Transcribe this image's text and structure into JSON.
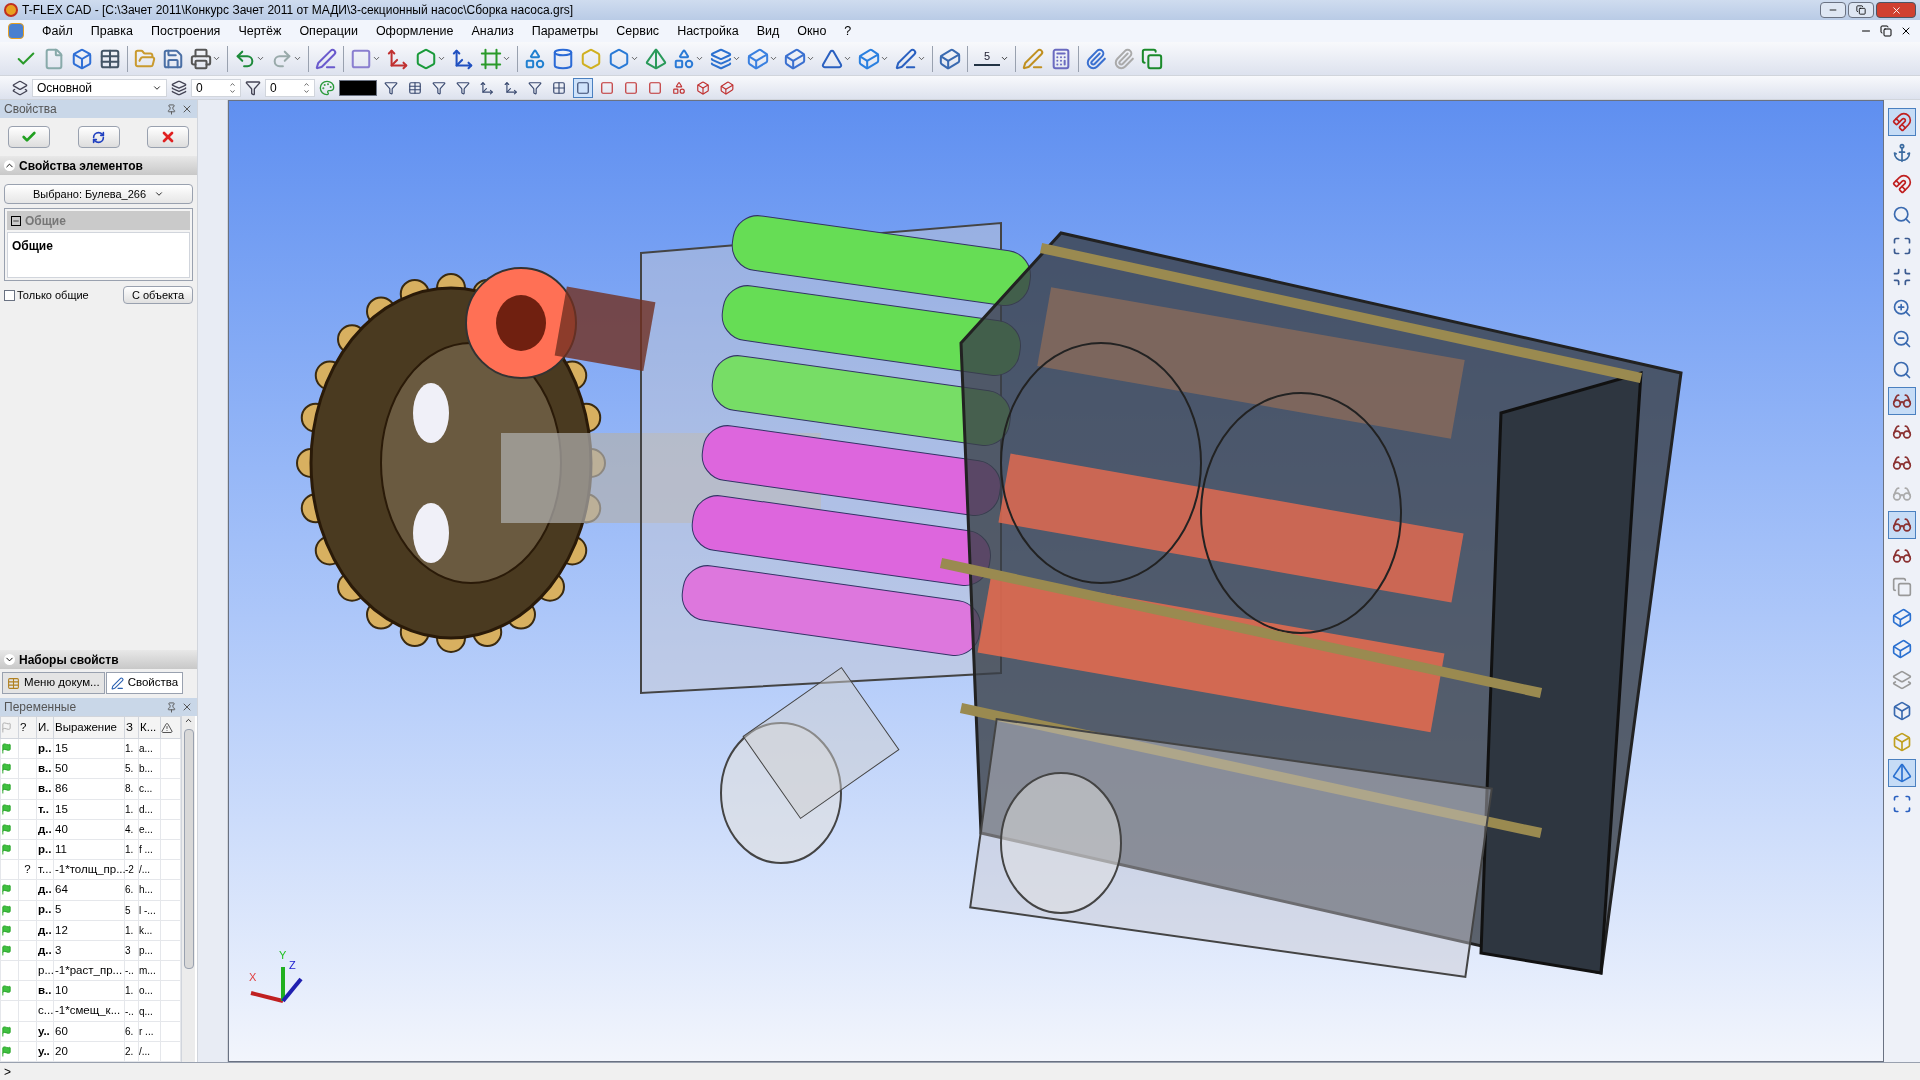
{
  "window": {
    "title": "T-FLEX CAD - [C:\\Зачет 2011\\Конкурс Зачет 2011 от МАДИ\\3-секционный насос\\Сборка насоса.grs]"
  },
  "menu": [
    "Файл",
    "Правка",
    "Построения",
    "Чертёж",
    "Операции",
    "Оформление",
    "Анализ",
    "Параметры",
    "Сервис",
    "Настройка",
    "Вид",
    "Окно",
    "?"
  ],
  "toolbar2": {
    "layer": "Основной",
    "spin1": "0",
    "spin2": "0",
    "color": "#000000"
  },
  "properties": {
    "title": "Свойства",
    "section": "Свойства элементов",
    "selection": "Выбрано: Булева_266",
    "group_header": "Общие",
    "group_content": "Общие",
    "only_common": {
      "label": "Только общие",
      "checked": false
    },
    "from_object": "С объекта"
  },
  "property_sets": {
    "title": "Наборы свойств",
    "tabs": [
      {
        "label": "Меню докум...",
        "selected": false
      },
      {
        "label": "Свойства",
        "selected": true
      }
    ]
  },
  "variables": {
    "title": "Переменные",
    "columns": [
      "?",
      "И.",
      "Выражение",
      "З",
      "К..."
    ],
    "rows": [
      {
        "flag": true,
        "mark": "",
        "name": "р..",
        "expression": "15",
        "value": "1.",
        "comment": "a..."
      },
      {
        "flag": true,
        "mark": "",
        "name": "в..",
        "expression": "50",
        "value": "5.",
        "comment": "b..."
      },
      {
        "flag": true,
        "mark": "",
        "name": "в..",
        "expression": "86",
        "value": "8.",
        "comment": "c..."
      },
      {
        "flag": true,
        "mark": "",
        "name": "т..",
        "expression": "15",
        "value": "1.",
        "comment": "d..."
      },
      {
        "flag": true,
        "mark": "",
        "name": "д..",
        "expression": "40",
        "value": "4.",
        "comment": "e..."
      },
      {
        "flag": true,
        "mark": "",
        "name": "р..",
        "expression": "11",
        "value": "1.",
        "comment": "f ..."
      },
      {
        "flag": false,
        "mark": "?",
        "name": "т...",
        "expression": "-1*толщ_пр...",
        "value": "-2",
        "comment": "/..."
      },
      {
        "flag": true,
        "mark": "",
        "name": "д..",
        "expression": "64",
        "value": "6.",
        "comment": "h..."
      },
      {
        "flag": true,
        "mark": "",
        "name": "р..",
        "expression": "5",
        "value": "5",
        "comment": "l -..."
      },
      {
        "flag": true,
        "mark": "",
        "name": "д..",
        "expression": "12",
        "value": "1.",
        "comment": "k..."
      },
      {
        "flag": true,
        "mark": "",
        "name": "д..",
        "expression": "3",
        "value": "3",
        "comment": "p..."
      },
      {
        "flag": false,
        "mark": "",
        "name": "р...",
        "expression": "-1*раст_пр...",
        "value": "-..",
        "comment": "m..."
      },
      {
        "flag": true,
        "mark": "",
        "name": "в..",
        "expression": "10",
        "value": "1.",
        "comment": "o..."
      },
      {
        "flag": false,
        "mark": "",
        "name": "с...",
        "expression": "-1*смещ_к...",
        "value": "-..",
        "comment": "q..."
      },
      {
        "flag": true,
        "mark": "",
        "name": "у..",
        "expression": "60",
        "value": "6.",
        "comment": "r ..."
      },
      {
        "flag": true,
        "mark": "",
        "name": "у..",
        "expression": "20",
        "value": "2.",
        "comment": "/..."
      }
    ]
  },
  "toolbar_dimension": "5",
  "triad": {
    "x": "X",
    "y": "Y",
    "z": "Z"
  },
  "right_toolbar": [
    {
      "selected": true
    },
    {
      "selected": false
    },
    {
      "selected": false
    },
    {
      "selected": false
    },
    {
      "selected": false
    },
    {
      "selected": false
    },
    {
      "selected": false
    },
    {
      "selected": false
    },
    {
      "selected": false
    },
    {
      "selected": true
    },
    {
      "selected": false
    },
    {
      "selected": false
    },
    {
      "selected": false
    },
    {
      "selected": true
    },
    {
      "selected": false
    },
    {
      "selected": false
    },
    {
      "selected": false
    },
    {
      "selected": false
    },
    {
      "selected": false
    },
    {
      "selected": false
    },
    {
      "selected": false
    },
    {
      "selected": true
    },
    {
      "selected": false
    }
  ],
  "status_bar": {
    "prompt": ">"
  }
}
